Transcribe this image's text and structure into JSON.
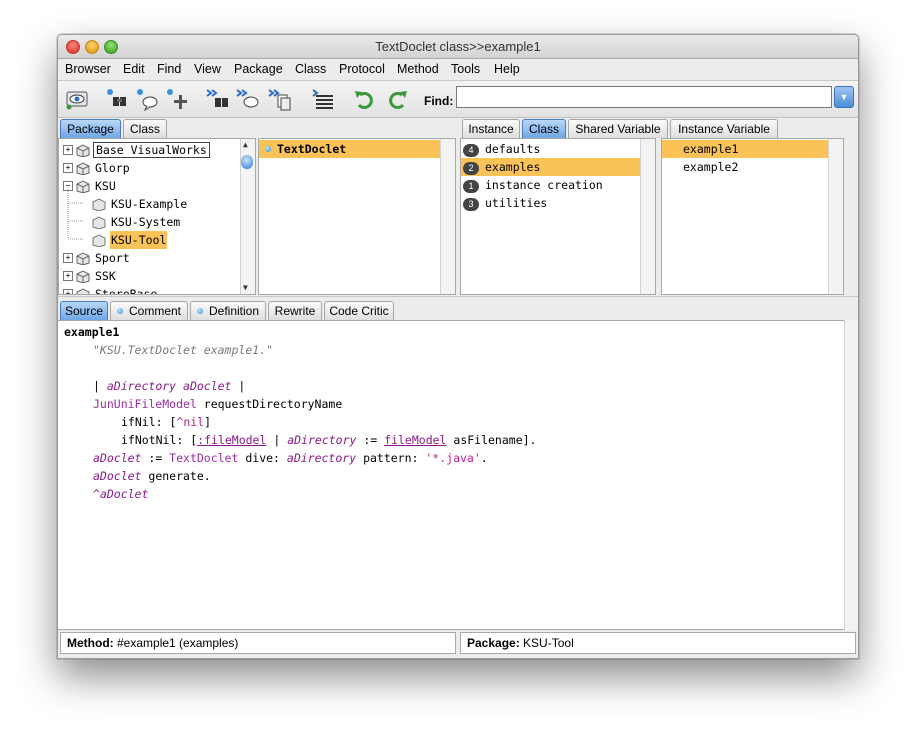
{
  "window": {
    "title": "TextDoclet class>>example1"
  },
  "menu": [
    "Browser",
    "Edit",
    "Find",
    "View",
    "Package",
    "Class",
    "Protocol",
    "Method",
    "Tools",
    "Help"
  ],
  "toolbar": {
    "find_label": "Find:",
    "find_value": ""
  },
  "nav_tabs": {
    "package": "Package",
    "class": "Class",
    "active": "Package"
  },
  "packages": [
    {
      "label": "Base VisualWorks",
      "expander": "+",
      "level": 0
    },
    {
      "label": "Glorp",
      "expander": "+",
      "level": 0
    },
    {
      "label": "KSU",
      "expander": "−",
      "level": 0
    },
    {
      "label": "KSU-Example",
      "expander": "",
      "level": 1
    },
    {
      "label": "KSU-System",
      "expander": "",
      "level": 1
    },
    {
      "label": "KSU-Tool",
      "expander": "",
      "level": 1,
      "selected": true
    },
    {
      "label": "Sport",
      "expander": "+",
      "level": 0
    },
    {
      "label": "SSK",
      "expander": "+",
      "level": 0
    },
    {
      "label": "StoreBase",
      "expander": "+",
      "level": 0
    }
  ],
  "classes": [
    {
      "label": "TextDoclet",
      "selected": true
    }
  ],
  "side_tabs": {
    "instance": "Instance",
    "class": "Class",
    "shared": "Shared Variable",
    "instvar": "Instance Variable",
    "active": "Class"
  },
  "protocols": [
    {
      "count": "4",
      "label": "defaults"
    },
    {
      "count": "2",
      "label": "examples",
      "selected": true
    },
    {
      "count": "1",
      "label": "instance creation"
    },
    {
      "count": "3",
      "label": "utilities"
    }
  ],
  "methods": [
    {
      "label": "example1",
      "selected": true
    },
    {
      "label": "example2"
    }
  ],
  "code_tabs": {
    "source": "Source",
    "comment": "Comment",
    "definition": "Definition",
    "rewrite": "Rewrite",
    "critic": "Code Critic",
    "active": "Source"
  },
  "code": {
    "l1": "example1",
    "l2": "\"KSU.TextDoclet example1.\"",
    "l4a": "| ",
    "l4b": "aDirectory aDoclet",
    "l4c": " |",
    "l5a": "JunUniFileModel",
    "l5b": " requestDirectoryName",
    "l6a": "ifNil: [",
    "l6b": "^nil",
    "l6c": "]",
    "l7a": "ifNotNil: [",
    "l7b": ":fileModel",
    "l7c": " | ",
    "l7d": "aDirectory",
    "l7e": " := ",
    "l7f": "fileModel",
    "l7g": " asFilename].",
    "l8a": "aDoclet",
    "l8b": " := ",
    "l8c": "TextDoclet",
    "l8d": " dive: ",
    "l8e": "aDirectory",
    "l8f": " pattern: ",
    "l8g": "'*.java'",
    "l8h": ".",
    "l9a": "aDoclet",
    "l9b": " generate.",
    "l10": "^aDoclet"
  },
  "status": {
    "method_label": "Method:",
    "method_value": "#example1 (examples)",
    "package_label": "Package:",
    "package_value": "KSU-Tool"
  },
  "colors": {
    "selection": "#fbc258",
    "tab_active": "#6fa6e6"
  }
}
